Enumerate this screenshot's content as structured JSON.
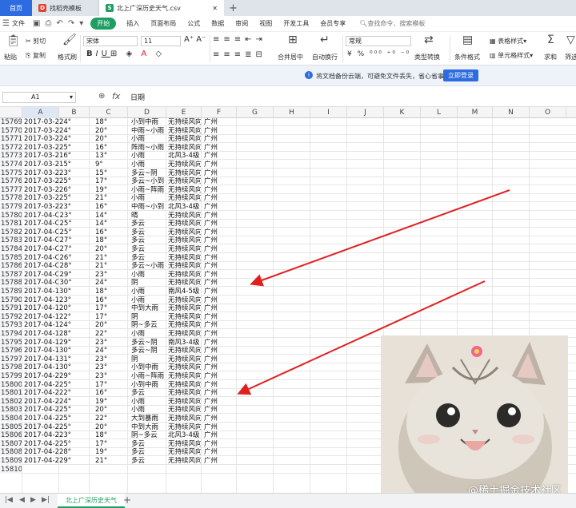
{
  "tabs": {
    "home": "首页",
    "docer": "找稻壳模板",
    "file": "北上广深历史天气.csv"
  },
  "menu": {
    "file": "文件",
    "items": [
      "开始",
      "插入",
      "页面布局",
      "公式",
      "数据",
      "审阅",
      "视图",
      "开发工具",
      "会员专享"
    ],
    "search": "查找命令、搜索模板"
  },
  "ribbon": {
    "cut": "剪切",
    "copy": "复制",
    "format_painter": "格式刷",
    "paste": "粘贴",
    "font_name": "宋体",
    "font_size": "11",
    "number_format": "常规",
    "merge": "合并居中",
    "wrap": "自动换行",
    "type_convert": "类型转换",
    "cond_format": "条件格式",
    "table_style": "表格样式",
    "cell_style": "单元格样式",
    "sum": "求和",
    "filter": "筛选"
  },
  "notice": {
    "icon": "i",
    "text": "将文档备份云端，可避免文件丢失，省心省事",
    "button": "立即登录"
  },
  "formula_bar": {
    "cell": "A1",
    "fx": "fx",
    "value": "日期"
  },
  "columns": [
    "A",
    "B",
    "C",
    "D",
    "E",
    "F",
    "G",
    "H",
    "I",
    "J",
    "K",
    "L",
    "M",
    "N",
    "O"
  ],
  "rows": [
    {
      "n": "15769",
      "a": "2017-03-224°",
      "c": "18°",
      "d": "小到中雨",
      "e": "无持续风向",
      "f": "广州"
    },
    {
      "n": "15770",
      "a": "2017-03-224°",
      "c": "20°",
      "d": "中雨~小雨",
      "e": "无持续风向",
      "f": "广州"
    },
    {
      "n": "15771",
      "a": "2017-03-224°",
      "c": "20°",
      "d": "小雨",
      "e": "无持续风向",
      "f": "广州"
    },
    {
      "n": "15772",
      "a": "2017-03-225°",
      "c": "16°",
      "d": "阵雨~小雨",
      "e": "无持续风向",
      "f": "广州"
    },
    {
      "n": "15773",
      "a": "2017-03-216°",
      "c": "13°",
      "d": "小雨",
      "e": "北风3-4级",
      "f": "广州"
    },
    {
      "n": "15774",
      "a": "2017-03-215°",
      "c": "9°",
      "d": "小雨",
      "e": "无持续风向",
      "f": "广州"
    },
    {
      "n": "15775",
      "a": "2017-03-223°",
      "c": "15°",
      "d": "多云~阴",
      "e": "无持续风向",
      "f": "广州"
    },
    {
      "n": "15776",
      "a": "2017-03-225°",
      "c": "17°",
      "d": "多云~小到",
      "e": "无持续风向",
      "f": "广州"
    },
    {
      "n": "15777",
      "a": "2017-03-226°",
      "c": "19°",
      "d": "小雨~阵雨",
      "e": "无持续风向",
      "f": "广州"
    },
    {
      "n": "15778",
      "a": "2017-03-225°",
      "c": "21°",
      "d": "小雨",
      "e": "无持续风向",
      "f": "广州"
    },
    {
      "n": "15779",
      "a": "2017-03-223°",
      "c": "16°",
      "d": "中雨~小到",
      "e": "北风3-4级",
      "f": "广州"
    },
    {
      "n": "15780",
      "a": "2017-04-C23°",
      "c": "14°",
      "d": "晴",
      "e": "无持续风向",
      "f": "广州"
    },
    {
      "n": "15781",
      "a": "2017-04-C25°",
      "c": "14°",
      "d": "多云",
      "e": "无持续风向",
      "f": "广州"
    },
    {
      "n": "15782",
      "a": "2017-04-C25°",
      "c": "16°",
      "d": "多云",
      "e": "无持续风向",
      "f": "广州"
    },
    {
      "n": "15783",
      "a": "2017-04-C27°",
      "c": "18°",
      "d": "多云",
      "e": "无持续风向",
      "f": "广州"
    },
    {
      "n": "15784",
      "a": "2017-04-C27°",
      "c": "20°",
      "d": "多云",
      "e": "无持续风向",
      "f": "广州"
    },
    {
      "n": "15785",
      "a": "2017-04-C26°",
      "c": "21°",
      "d": "多云",
      "e": "无持续风向",
      "f": "广州"
    },
    {
      "n": "15786",
      "a": "2017-04-C28°",
      "c": "21°",
      "d": "多云~小雨",
      "e": "无持续风向",
      "f": "广州"
    },
    {
      "n": "15787",
      "a": "2017-04-C29°",
      "c": "23°",
      "d": "小雨",
      "e": "无持续风向",
      "f": "广州"
    },
    {
      "n": "15788",
      "a": "2017-04-C30°",
      "c": "24°",
      "d": "阴",
      "e": "无持续风向",
      "f": "广州"
    },
    {
      "n": "15789",
      "a": "2017-04-130°",
      "c": "18°",
      "d": "小雨",
      "e": "南风4-5级",
      "f": "广州"
    },
    {
      "n": "15790",
      "a": "2017-04-123°",
      "c": "16°",
      "d": "小雨",
      "e": "无持续风向",
      "f": "广州"
    },
    {
      "n": "15791",
      "a": "2017-04-120°",
      "c": "17°",
      "d": "中到大雨",
      "e": "无持续风向",
      "f": "广州"
    },
    {
      "n": "15792",
      "a": "2017-04-122°",
      "c": "17°",
      "d": "阴",
      "e": "无持续风向",
      "f": "广州"
    },
    {
      "n": "15793",
      "a": "2017-04-124°",
      "c": "20°",
      "d": "阴~多云",
      "e": "无持续风向",
      "f": "广州"
    },
    {
      "n": "15794",
      "a": "2017-04-128°",
      "c": "22°",
      "d": "小雨",
      "e": "无持续风向",
      "f": "广州"
    },
    {
      "n": "15795",
      "a": "2017-04-129°",
      "c": "23°",
      "d": "多云~阴",
      "e": "南风3-4级",
      "f": "广州"
    },
    {
      "n": "15796",
      "a": "2017-04-130°",
      "c": "24°",
      "d": "多云~阴",
      "e": "无持续风向",
      "f": "广州"
    },
    {
      "n": "15797",
      "a": "2017-04-131°",
      "c": "23°",
      "d": "阴",
      "e": "无持续风向",
      "f": "广州"
    },
    {
      "n": "15798",
      "a": "2017-04-130°",
      "c": "23°",
      "d": "小到中雨",
      "e": "无持续风向",
      "f": "广州"
    },
    {
      "n": "15799",
      "a": "2017-04-229°",
      "c": "23°",
      "d": "小雨~阵雨",
      "e": "无持续风向",
      "f": "广州"
    },
    {
      "n": "15800",
      "a": "2017-04-225°",
      "c": "17°",
      "d": "小到中雨",
      "e": "无持续风向",
      "f": "广州"
    },
    {
      "n": "15801",
      "a": "2017-04-222°",
      "c": "16°",
      "d": "多云",
      "e": "无持续风向",
      "f": "广州"
    },
    {
      "n": "15802",
      "a": "2017-04-224°",
      "c": "19°",
      "d": "小雨",
      "e": "无持续风向",
      "f": "广州"
    },
    {
      "n": "15803",
      "a": "2017-04-225°",
      "c": "20°",
      "d": "小雨",
      "e": "无持续风向",
      "f": "广州"
    },
    {
      "n": "15804",
      "a": "2017-04-225°",
      "c": "22°",
      "d": "大到暴雨",
      "e": "无持续风向",
      "f": "广州"
    },
    {
      "n": "15805",
      "a": "2017-04-225°",
      "c": "20°",
      "d": "中到大雨",
      "e": "无持续风向",
      "f": "广州"
    },
    {
      "n": "15806",
      "a": "2017-04-223°",
      "c": "18°",
      "d": "阴~多云",
      "e": "北风3-4级",
      "f": "广州"
    },
    {
      "n": "15807",
      "a": "2017-04-225°",
      "c": "17°",
      "d": "多云",
      "e": "无持续风向",
      "f": "广州"
    },
    {
      "n": "15808",
      "a": "2017-04-228°",
      "c": "19°",
      "d": "多云",
      "e": "无持续风向",
      "f": "广州"
    },
    {
      "n": "15809",
      "a": "2017-04-229°",
      "c": "21°",
      "d": "多云",
      "e": "无持续风向",
      "f": "广州"
    },
    {
      "n": "15810",
      "a": "",
      "c": "",
      "d": "",
      "e": "",
      "f": ""
    }
  ],
  "sheet_tab": "北上广深历史天气",
  "overlay": {
    "watermark": "@稀土掘金技术社区"
  },
  "colors": {
    "accent": "#1f9e62",
    "brand_blue": "#2d6be0",
    "arrow": "#e02020"
  }
}
